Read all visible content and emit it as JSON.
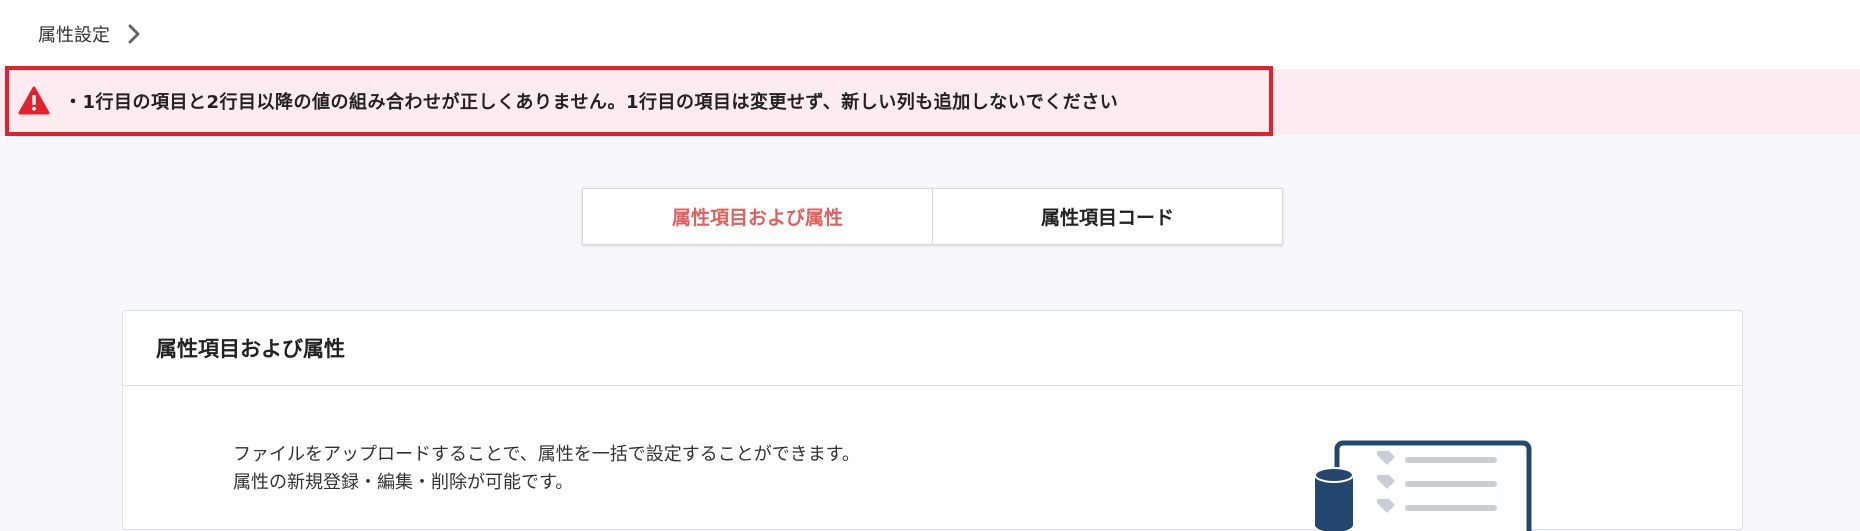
{
  "breadcrumb": {
    "current": "属性設定",
    "chevron_icon": "chevron-right-icon"
  },
  "alert": {
    "icon": "warning-triangle-icon",
    "message": "・1行目の項目と2行目以降の値の組み合わせが正しくありません。1行目の項目は変更せず、新しい列も追加しないでください",
    "border_color": "#e3202c",
    "background_color": "#fdecef"
  },
  "tabs": [
    {
      "label": "属性項目および属性",
      "active": true
    },
    {
      "label": "属性項目コード",
      "active": false
    }
  ],
  "accent_color": "#e0605e",
  "card": {
    "title": "属性項目および属性",
    "description_line1": "ファイルをアップロードすることで、属性を一括で設定することができます。",
    "description_line2": "属性の新規登録・編集・削除が可能です。",
    "illustration_icon": "database-document-icon",
    "illustration_color": "#23476e"
  }
}
